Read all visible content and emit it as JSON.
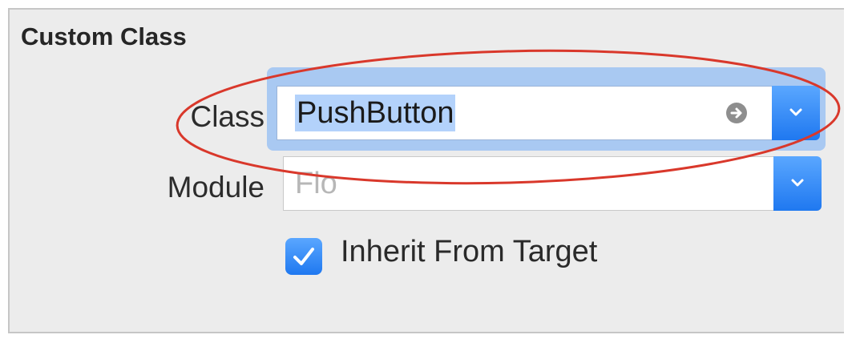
{
  "panel": {
    "title": "Custom Class"
  },
  "class_field": {
    "label": "Class",
    "value": "PushButton",
    "go_icon": "arrow-right-circle-icon",
    "dropdown_icon": "chevron-down-icon"
  },
  "module_field": {
    "label": "Module",
    "placeholder": "Flo",
    "dropdown_icon": "chevron-down-icon"
  },
  "inherit_checkbox": {
    "label": "Inherit From Target",
    "checked": true
  },
  "colors": {
    "accent": "#1f78f0",
    "focus_ring": "#a9c9f2",
    "selection": "#b3d2fb",
    "annotation": "#d9382b",
    "panel_bg": "#ececec"
  }
}
